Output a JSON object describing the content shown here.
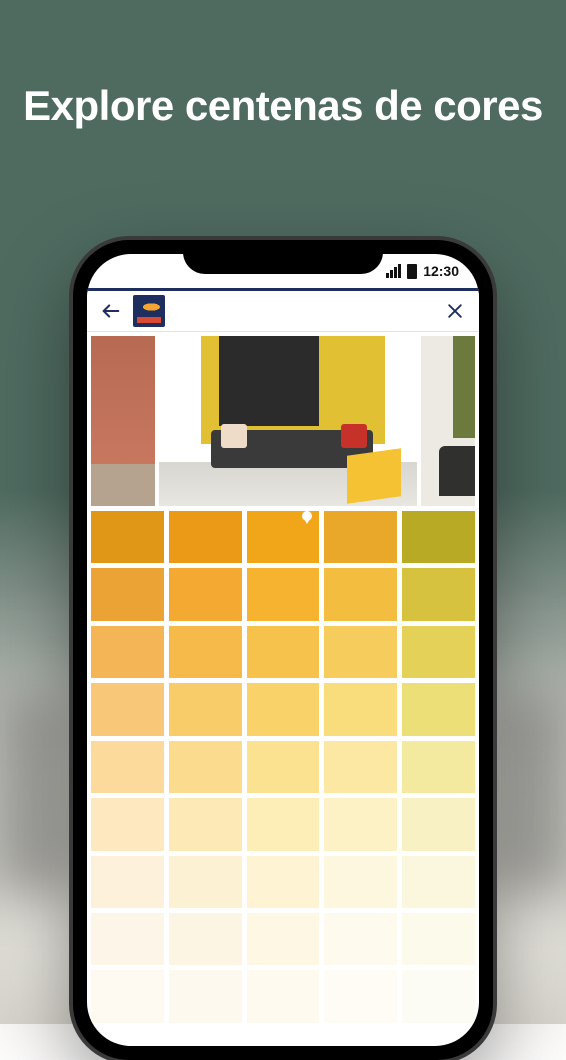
{
  "marketing": {
    "headline": "Explore centenas de cores"
  },
  "status": {
    "time": "12:30"
  },
  "topbar": {
    "logo_name": "brand-logo"
  },
  "palette": {
    "pinned_index": 2,
    "colors": [
      [
        "#e09617",
        "#eb9a17",
        "#f0a618",
        "#e9a82a",
        "#b9aa25"
      ],
      [
        "#eca335",
        "#f3a932",
        "#f5b32f",
        "#f3bd3f",
        "#d6c23e"
      ],
      [
        "#f3b556",
        "#f5ba4a",
        "#f7c24c",
        "#f6cd5c",
        "#e3d257"
      ],
      [
        "#f8c878",
        "#f8cc69",
        "#f9d369",
        "#f9dd7c",
        "#eddf78"
      ],
      [
        "#fbda9c",
        "#fbdc8e",
        "#fbe291",
        "#fce8a2",
        "#f3e99f"
      ],
      [
        "#fde8c0",
        "#fde9b5",
        "#fdedb7",
        "#fdf1c6",
        "#f8f1c3"
      ],
      [
        "#fdf1dc",
        "#fdf1d4",
        "#fef4d4",
        "#fef7e0",
        "#fbf7de"
      ],
      [
        "#fdf5e8",
        "#fdf5e3",
        "#fef7e3",
        "#fefaed",
        "#fcfaeb"
      ],
      [
        "#fefaf2",
        "#fdf9ef",
        "#fefaf0",
        "#fefcf5",
        "#fdfcf4"
      ]
    ]
  }
}
